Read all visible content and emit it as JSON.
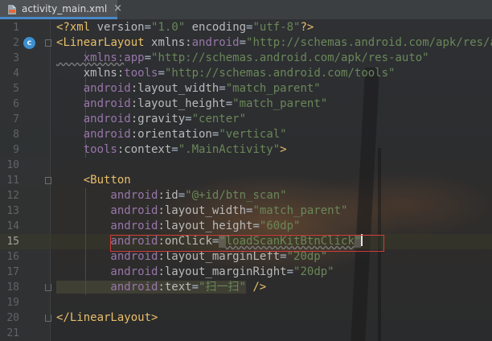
{
  "tab": {
    "filename": "activity_main.xml",
    "close": "×",
    "icon": "xml-file-icon"
  },
  "gutter_icons": {
    "line2": "class-c-icon"
  },
  "lines": [
    {
      "n": "1",
      "tokens": [
        [
          "pun",
          "<?"
        ],
        [
          "tag",
          "xml "
        ],
        [
          "attr",
          "version"
        ],
        [
          "eq",
          "="
        ],
        [
          "val",
          "\"1.0\""
        ],
        [
          "attr",
          " encoding"
        ],
        [
          "eq",
          "="
        ],
        [
          "val",
          "\"utf-8\""
        ],
        [
          "pun",
          "?>"
        ]
      ]
    },
    {
      "n": "2",
      "tokens": [
        [
          "pun",
          "<"
        ],
        [
          "tag",
          "LinearLayout "
        ],
        [
          "attr",
          "xmlns:"
        ],
        [
          "ns",
          "android"
        ],
        [
          "eq",
          "="
        ],
        [
          "val",
          "\"http://schemas.android.com/apk/res/android\""
        ]
      ]
    },
    {
      "n": "3",
      "tokens": [
        [
          "ns",
          "    xmlns:"
        ],
        [
          "ns",
          "app"
        ],
        [
          "eq",
          "="
        ],
        [
          "val",
          "\"http://schemas.android.com/apk/res-auto\""
        ]
      ]
    },
    {
      "n": "4",
      "tokens": [
        [
          "attr",
          "    xmlns:"
        ],
        [
          "ns",
          "tools"
        ],
        [
          "eq",
          "="
        ],
        [
          "val",
          "\"http://schemas.android.com/tools\""
        ]
      ]
    },
    {
      "n": "5",
      "tokens": [
        [
          "ns",
          "    android"
        ],
        [
          "attr",
          ":layout_width"
        ],
        [
          "eq",
          "="
        ],
        [
          "val",
          "\"match_parent\""
        ]
      ]
    },
    {
      "n": "6",
      "tokens": [
        [
          "ns",
          "    android"
        ],
        [
          "attr",
          ":layout_height"
        ],
        [
          "eq",
          "="
        ],
        [
          "val",
          "\"match_parent\""
        ]
      ]
    },
    {
      "n": "7",
      "tokens": [
        [
          "ns",
          "    android"
        ],
        [
          "attr",
          ":gravity"
        ],
        [
          "eq",
          "="
        ],
        [
          "val",
          "\"center\""
        ]
      ]
    },
    {
      "n": "8",
      "tokens": [
        [
          "ns",
          "    android"
        ],
        [
          "attr",
          ":orientation"
        ],
        [
          "eq",
          "="
        ],
        [
          "val",
          "\"vertical\""
        ]
      ]
    },
    {
      "n": "9",
      "tokens": [
        [
          "ns",
          "    tools"
        ],
        [
          "attr",
          ":context"
        ],
        [
          "eq",
          "="
        ],
        [
          "val",
          "\".MainActivity\""
        ],
        [
          "pun",
          ">"
        ]
      ]
    },
    {
      "n": "10",
      "tokens": []
    },
    {
      "n": "11",
      "tokens": [
        [
          "pun",
          "    <"
        ],
        [
          "tag",
          "Button"
        ]
      ]
    },
    {
      "n": "12",
      "tokens": [
        [
          "ns",
          "        android"
        ],
        [
          "attr",
          ":id"
        ],
        [
          "eq",
          "="
        ],
        [
          "val",
          "\"@+id/btn_scan\""
        ]
      ]
    },
    {
      "n": "13",
      "tokens": [
        [
          "ns",
          "        android"
        ],
        [
          "attr",
          ":layout_width"
        ],
        [
          "eq",
          "="
        ],
        [
          "val",
          "\"match_parent\""
        ]
      ]
    },
    {
      "n": "14",
      "tokens": [
        [
          "ns",
          "        android"
        ],
        [
          "attr",
          ":layout_height"
        ],
        [
          "eq",
          "="
        ],
        [
          "val",
          "\"60dp\""
        ]
      ]
    },
    {
      "n": "15",
      "tokens": [
        [
          "ns",
          "        android"
        ],
        [
          "attr",
          ":onClick"
        ],
        [
          "eq",
          "="
        ],
        [
          "val",
          "\"loadScanKitBtnClick\""
        ]
      ]
    },
    {
      "n": "16",
      "tokens": [
        [
          "ns",
          "        android"
        ],
        [
          "attr",
          ":layout_marginLeft"
        ],
        [
          "eq",
          "="
        ],
        [
          "val",
          "\"20dp\""
        ]
      ]
    },
    {
      "n": "17",
      "tokens": [
        [
          "ns",
          "        android"
        ],
        [
          "attr",
          ":layout_marginRight"
        ],
        [
          "eq",
          "="
        ],
        [
          "val",
          "\"20dp\""
        ]
      ]
    },
    {
      "n": "18",
      "tokens": [
        [
          "ns",
          "        android"
        ],
        [
          "attr",
          ":text"
        ],
        [
          "eq",
          "="
        ],
        [
          "val",
          "\"扫一扫\""
        ],
        [
          "pun",
          " />"
        ]
      ]
    },
    {
      "n": "19",
      "tokens": []
    },
    {
      "n": "20",
      "tokens": [
        [
          "pun",
          "</"
        ],
        [
          "tag",
          "LinearLayout"
        ],
        [
          "pun",
          ">"
        ]
      ]
    },
    {
      "n": "21",
      "tokens": []
    }
  ]
}
